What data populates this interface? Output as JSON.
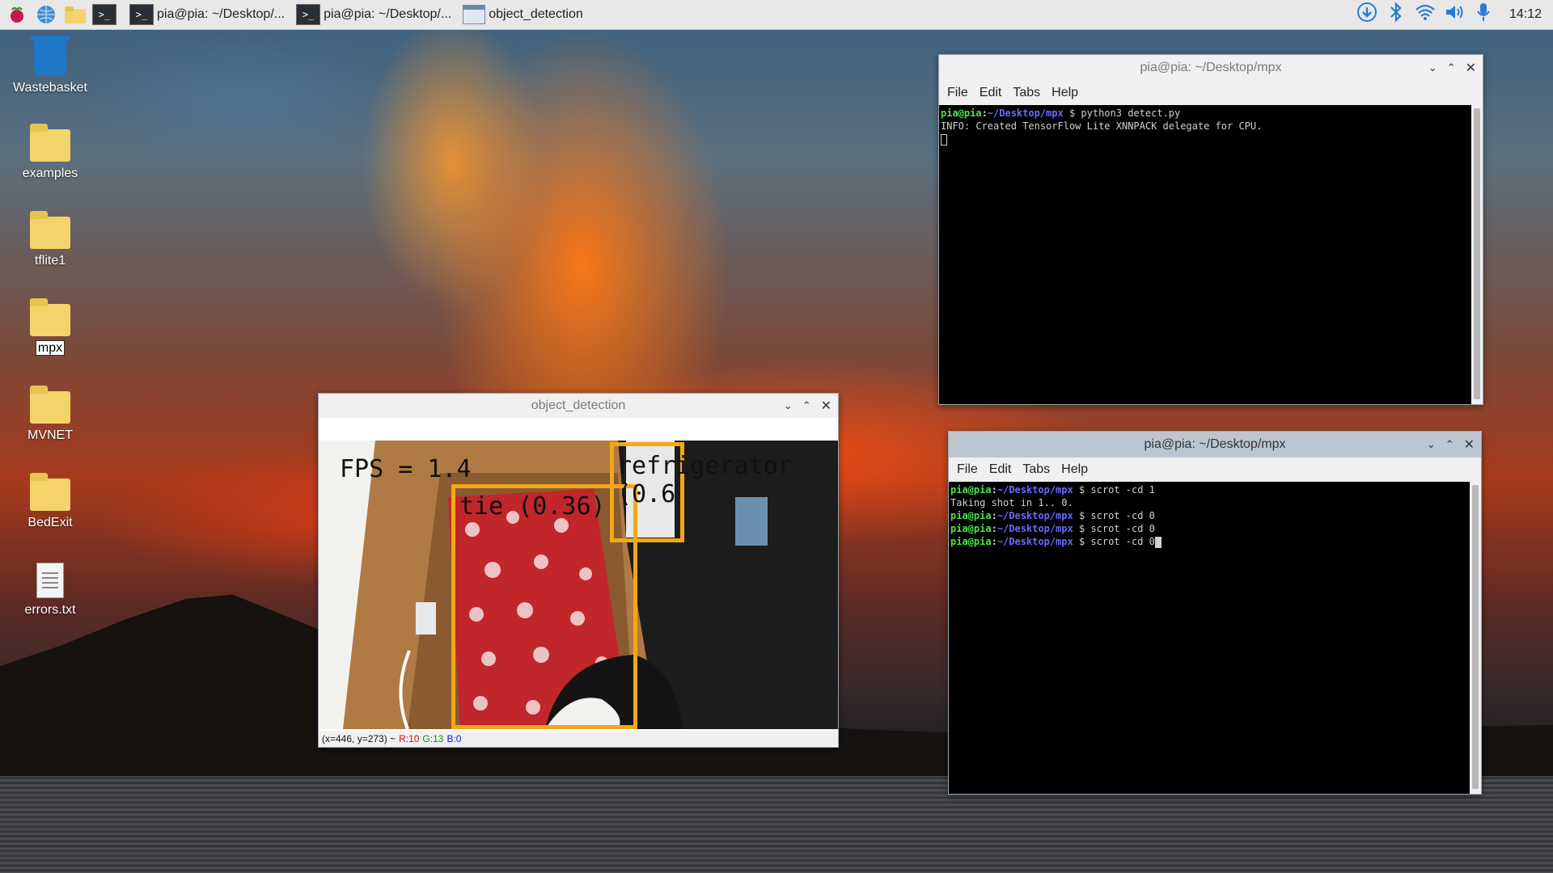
{
  "taskbar": {
    "launchers": [
      {
        "icon": "raspberry-menu-icon"
      },
      {
        "icon": "web-browser-icon"
      },
      {
        "icon": "file-manager-icon"
      },
      {
        "icon": "terminal-icon"
      }
    ],
    "tasks": [
      {
        "label": "pia@pia: ~/Desktop/...",
        "icon": "terminal-icon"
      },
      {
        "label": "pia@pia: ~/Desktop/...",
        "icon": "terminal-icon"
      },
      {
        "label": "object_detection",
        "icon": "window-icon"
      }
    ],
    "tray": [
      "download-icon",
      "bluetooth-icon",
      "wifi-icon",
      "volume-icon",
      "microphone-icon"
    ],
    "clock": "14:12"
  },
  "desktop": {
    "icons": [
      {
        "label": "Wastebasket",
        "type": "trash"
      },
      {
        "label": "examples",
        "type": "folder"
      },
      {
        "label": "tflite1",
        "type": "folder"
      },
      {
        "label": "mpx",
        "type": "folder",
        "selected": true
      },
      {
        "label": "MVNET",
        "type": "folder"
      },
      {
        "label": "BedExit",
        "type": "folder"
      },
      {
        "label": "errors.txt",
        "type": "file"
      }
    ]
  },
  "terminal1": {
    "title": "pia@pia: ~/Desktop/mpx",
    "menu": [
      "File",
      "Edit",
      "Tabs",
      "Help"
    ],
    "lines": [
      {
        "user": "pia@pia",
        "path": "~/Desktop/mpx",
        "cmd": " $ python3 detect.py"
      },
      {
        "text": "INFO: Created TensorFlow Lite XNNPACK delegate for CPU."
      }
    ]
  },
  "terminal2": {
    "title": "pia@pia: ~/Desktop/mpx",
    "menu": [
      "File",
      "Edit",
      "Tabs",
      "Help"
    ],
    "lines": [
      {
        "user": "pia@pia",
        "path": "~/Desktop/mpx",
        "cmd": " $ scrot -cd 1"
      },
      {
        "text": "Taking shot in 1.. 0."
      },
      {
        "user": "pia@pia",
        "path": "~/Desktop/mpx",
        "cmd": " $ scrot -cd 0"
      },
      {
        "user": "pia@pia",
        "path": "~/Desktop/mpx",
        "cmd": " $ scrot -cd 0"
      },
      {
        "user": "pia@pia",
        "path": "~/Desktop/mpx",
        "cmd": " $ scrot -cd 0"
      }
    ]
  },
  "object_detection": {
    "title": "object_detection",
    "fps_text": "FPS = 1.4",
    "detections": [
      {
        "label": "refrigerator (0.6",
        "color": "#f0a818"
      },
      {
        "label": "tie (0.36)",
        "color": "#f0a818"
      }
    ],
    "status": {
      "coords": "(x=446, y=273) ~",
      "r": "R:10",
      "g": "G:13",
      "b": "B:0"
    }
  },
  "colors": {
    "prompt_user": "#4fe04f",
    "prompt_path": "#6a6aff",
    "detection_box": "#f0a818",
    "accent": "#2a7ad6"
  }
}
